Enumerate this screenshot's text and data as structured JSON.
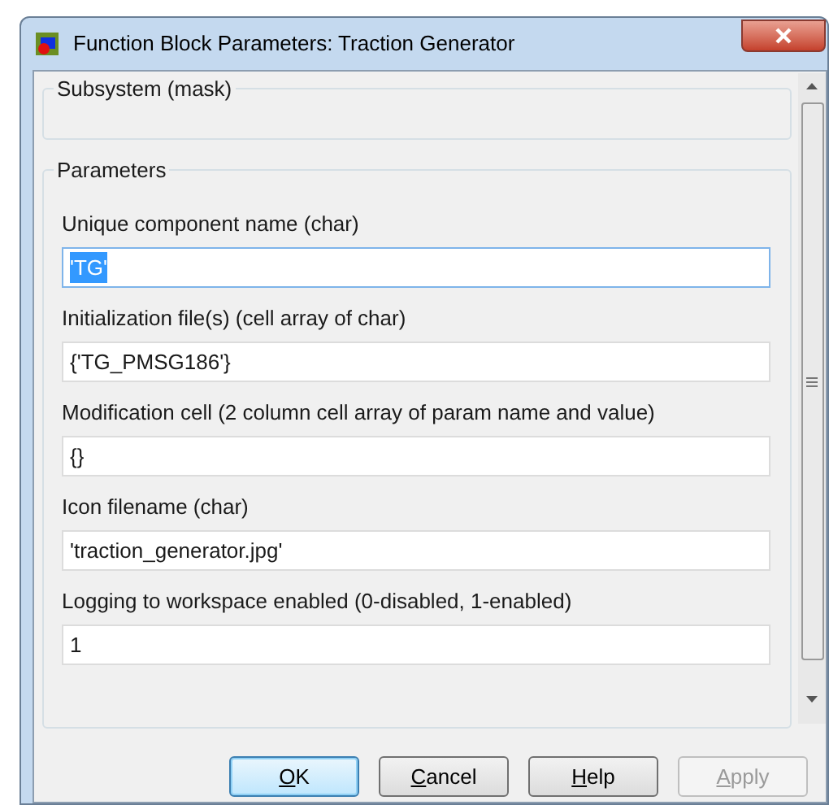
{
  "window": {
    "title": "Function Block Parameters: Traction Generator"
  },
  "description_group": {
    "title": "Subsystem (mask)"
  },
  "parameters_group": {
    "title": "Parameters",
    "fields": [
      {
        "label": "Unique component name (char)",
        "value": "'TG'",
        "text_selected": true
      },
      {
        "label": "Initialization file(s) (cell array of char)",
        "value": "{'TG_PMSG186'}",
        "text_selected": false
      },
      {
        "label": "Modification cell (2 column cell array of param name and value)",
        "value": "{}",
        "text_selected": false
      },
      {
        "label": "Icon filename (char)",
        "value": "'traction_generator.jpg'",
        "text_selected": false
      },
      {
        "label": "Logging to workspace enabled (0-disabled, 1-enabled)",
        "value": "1",
        "text_selected": false
      }
    ]
  },
  "buttons": [
    {
      "label": "OK",
      "default": true,
      "disabled": false
    },
    {
      "label": "Cancel",
      "default": false,
      "disabled": false
    },
    {
      "label": "Help",
      "default": false,
      "disabled": false
    },
    {
      "label": "Apply",
      "default": false,
      "disabled": true
    }
  ]
}
